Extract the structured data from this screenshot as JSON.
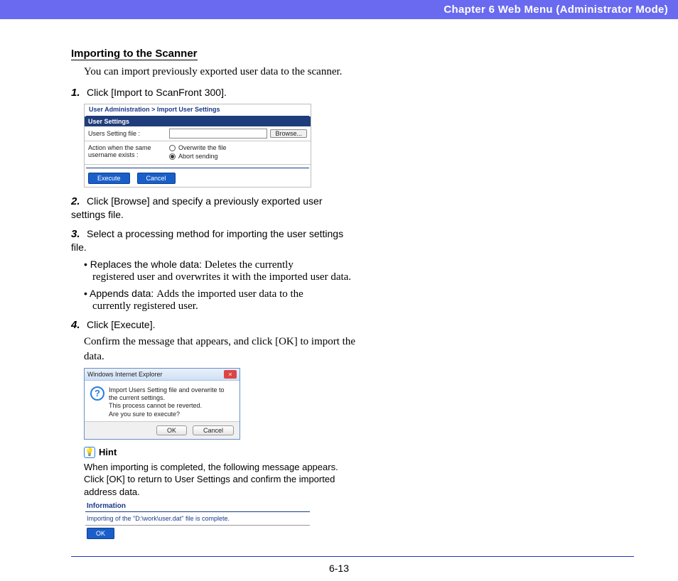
{
  "header": {
    "chapter": "Chapter 6   Web Menu (Administrator Mode)"
  },
  "section": {
    "title": "Importing to the Scanner",
    "intro": "You can import previously exported user data to the scanner."
  },
  "steps": {
    "s1": {
      "num": "1.",
      "text": "Click [Import to ScanFront 300]."
    },
    "s2": {
      "num": "2.",
      "text": "Click [Browse] and specify a previously exported user settings file."
    },
    "s3": {
      "num": "3.",
      "text": "Select a processing method for importing the user settings file.",
      "bullets": [
        {
          "label": "• Replaces the whole data: ",
          "desc": "Deletes the currently",
          "cont": "registered user and overwrites it with the imported user data."
        },
        {
          "label": "• Appends data: ",
          "desc": "Adds the imported user data to the",
          "cont": "currently registered user."
        }
      ]
    },
    "s4": {
      "num": "4.",
      "text": "Click [Execute].",
      "serif": "Confirm the message that appears, and click [OK] to import the data."
    }
  },
  "fig1": {
    "breadcrumb": "User Administration > Import User Settings",
    "panel_head": "User Settings",
    "row1_label": "Users Setting file :",
    "browse": "Browse...",
    "row2_label_a": "Action when the same",
    "row2_label_b": "username exists :",
    "opt1": "Overwrite the file",
    "opt2": "Abort sending",
    "execute": "Execute",
    "cancel": "Cancel"
  },
  "fig2": {
    "title": "Windows Internet Explorer",
    "line1": "Import Users Setting file and overwrite to the current settings.",
    "line2": "This process cannot be reverted.",
    "line3": "Are you sure to execute?",
    "ok": "OK",
    "cancel": "Cancel"
  },
  "hint": {
    "label": "Hint",
    "text": "When importing is completed, the following message appears. Click [OK] to return to User Settings and confirm the imported address data."
  },
  "fig3": {
    "head": "Information",
    "msg": "Importing of the \"D:\\work\\user.dat\" file is complete.",
    "ok": "OK"
  },
  "footer": {
    "page": "6-13"
  }
}
